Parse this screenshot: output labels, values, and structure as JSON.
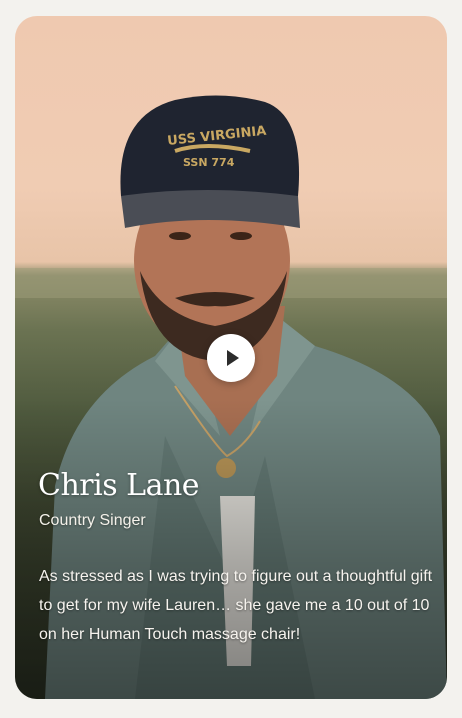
{
  "testimonial": {
    "name": "Chris Lane",
    "role": "Country Singer",
    "quote": "As stressed as I was trying to figure out a thoughtful gift to get for my wife Lauren… she gave me a 10 out of 10 on her Human Touch massage chair!",
    "cap_text_line1": "USS VIRGINIA",
    "cap_text_line2": "SSN 774",
    "play_icon": "play-icon"
  },
  "colors": {
    "sky": "#efc9b0",
    "field": "#5a6444",
    "shirt": "#7a8f8a",
    "cap": "#1f2430",
    "play_button": "#ffffff"
  }
}
